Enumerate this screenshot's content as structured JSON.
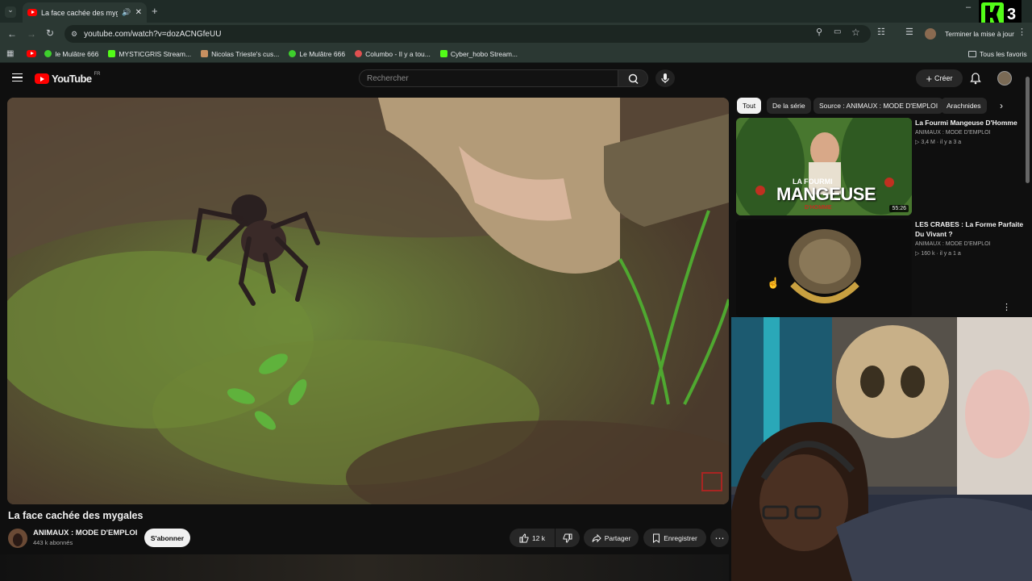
{
  "browser": {
    "tab_title": "La face cachée des mygales",
    "url": "youtube.com/watch?v=dozACNGfeUU",
    "update_button": "Terminer la mise à jour",
    "bookmarks": [
      {
        "label": "le Mulâtre 666",
        "color": "#3ecf2d"
      },
      {
        "label": "MYSTICGRIS Stream...",
        "color": "#53fc18"
      },
      {
        "label": "Nicolas Trieste's cus...",
        "color": "#c89060"
      },
      {
        "label": "Le Mulâtre 666",
        "color": "#3ecf2d"
      },
      {
        "label": "Columbo - Il y a tou...",
        "color": "#e05050"
      },
      {
        "label": "Cyber_hobo Stream...",
        "color": "#53fc18"
      }
    ],
    "all_bookmarks": "Tous les favoris"
  },
  "youtube": {
    "logo_text": "YouTube",
    "region": "FR",
    "search_placeholder": "Rechercher",
    "create_label": "Créer"
  },
  "video": {
    "title": "La face cachée des mygales",
    "channel": "ANIMAUX : MODE D'EMPLOI",
    "subscribers": "443 k abonnés",
    "subscribe_label": "S'abonner",
    "likes": "12 k",
    "share_label": "Partager",
    "save_label": "Enregistrer"
  },
  "chips": [
    "Tout",
    "De la série",
    "Source : ANIMAUX : MODE D'EMPLOI",
    "Arachnides"
  ],
  "recommendations": [
    {
      "title": "La Fourmi Mangeuse D'Homme",
      "channel": "ANIMAUX : MODE D'EMPLOI",
      "meta": "3,4 M · il y a 3 a",
      "duration": "55:26",
      "thumb_text_1": "LA FOURMI",
      "thumb_text_2": "MANGEUSE",
      "thumb_text_3": "D'HOMME"
    },
    {
      "title": "LES CRABES : La Forme Parfaite Du Vivant ?",
      "channel": "ANIMAUX : MODE D'EMPLOI",
      "meta": "160 k · il y a 1 a"
    }
  ],
  "overlay_badge": {
    "letter": "K",
    "number": "3"
  }
}
